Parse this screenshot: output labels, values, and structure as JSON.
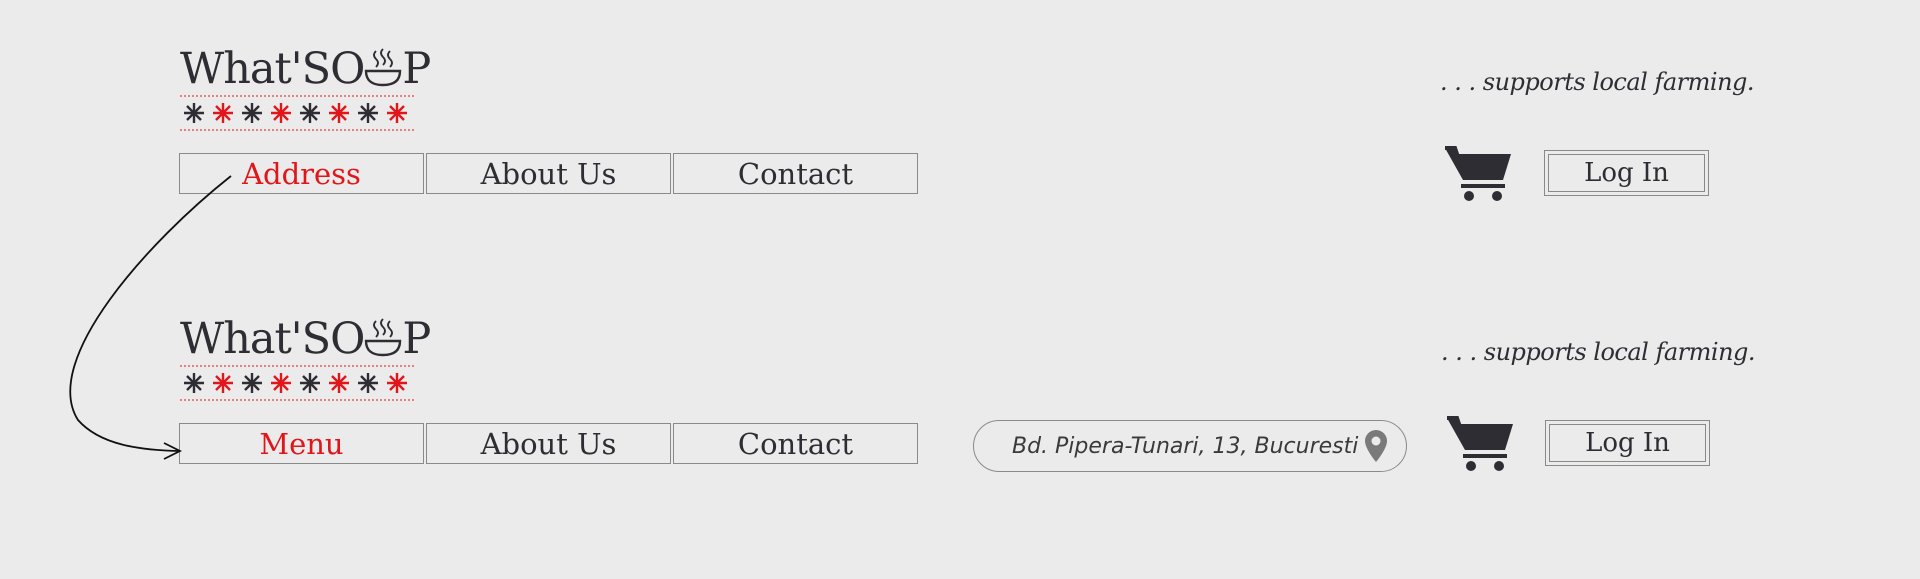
{
  "brand": {
    "logo_text_prefix": "What'SO",
    "logo_text_suffix": "P",
    "tagline": ". . . supports local farming."
  },
  "colors": {
    "accent": "#e0161b",
    "text": "#2d2d33",
    "background": "#ebebeb",
    "border": "#8a8a8a"
  },
  "state_1": {
    "nav": [
      {
        "label": "Address"
      },
      {
        "label": "About Us"
      },
      {
        "label": "Contact"
      }
    ],
    "login_label": "Log In",
    "cart_icon": "shopping-cart-icon"
  },
  "state_2": {
    "nav": [
      {
        "label": "Menu"
      },
      {
        "label": "About Us"
      },
      {
        "label": "Contact"
      }
    ],
    "address": "Bd. Pipera-Tunari, 13, Bucuresti",
    "address_icon": "location-pin-icon",
    "login_label": "Log In",
    "cart_icon": "shopping-cart-icon"
  }
}
